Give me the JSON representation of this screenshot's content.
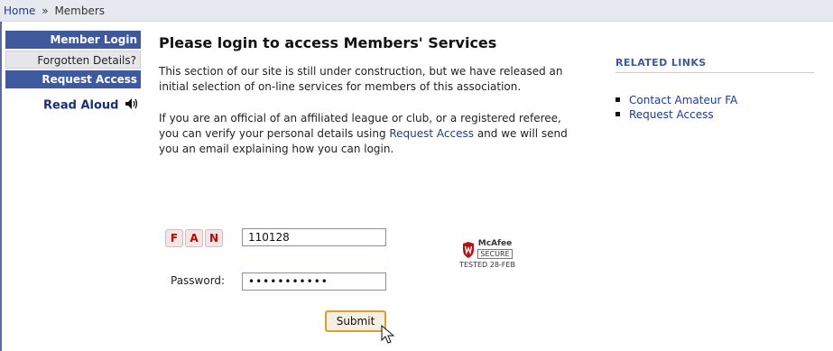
{
  "breadcrumb": {
    "home": "Home",
    "separator": "»",
    "current": "Members"
  },
  "sidebar": {
    "items": [
      {
        "label": "Member Login"
      },
      {
        "label": "Forgotten Details?"
      },
      {
        "label": "Request Access"
      }
    ],
    "read_aloud": {
      "label": "Read Aloud",
      "icon": "speaker-icon"
    }
  },
  "main": {
    "title": "Please login to access Members' Services",
    "para1": "This section of our site is still under construction, but we have released an initial selection of on-line services for members of this association.",
    "para2_before": "If you are an official of an affiliated league or club, or a registered referee, you can verify your personal details using ",
    "para2_link": "Request Access",
    "para2_after": " and we will send you an email explaining how you can login."
  },
  "form": {
    "fan_letters": [
      "F",
      "A",
      "N"
    ],
    "fan_value": "110128",
    "password_label": "Password:",
    "password_value": "•••••••••••",
    "submit_label": "Submit"
  },
  "mcafee": {
    "brand": "McAfee",
    "secure": "SECURE",
    "tested": "TESTED 28-FEB"
  },
  "related": {
    "title": "RELATED LINKS",
    "links": [
      "Contact Amateur FA",
      "Request Access"
    ]
  },
  "colors": {
    "sidebar_blue": "#3e5a9d",
    "link": "#1f3b8c",
    "submit_border": "#d7a12b"
  }
}
